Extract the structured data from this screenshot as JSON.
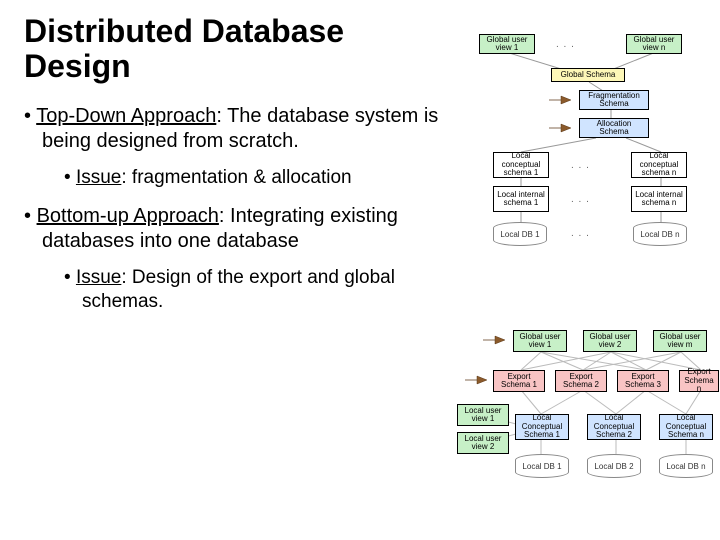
{
  "title": "Distributed Database Design",
  "bullets": {
    "b1_label": "Top-Down Approach",
    "b1_text": ":  The database system is being designed from scratch.",
    "b1_issue_label": "Issue",
    "b1_issue_text": ":  fragmentation & allocation",
    "b2_label": "Bottom-up Approach",
    "b2_text": ": Integrating existing databases into one database",
    "b2_issue_label": "Issue",
    "b2_issue_text": ":  Design of the export and global schemas."
  },
  "diagram1": {
    "global_user_view_1": "Global user view 1",
    "global_user_view_n": "Global user view n",
    "global_schema": "Global Schema",
    "fragmentation_schema": "Fragmentation Schema",
    "allocation_schema": "Allocation Schema",
    "local_conceptual_1": "Local conceptual schema 1",
    "local_conceptual_n": "Local conceptual schema n",
    "local_internal_1": "Local internal schema 1",
    "local_internal_n": "Local internal schema n",
    "local_db_1": "Local DB 1",
    "local_db_n": "Local DB n"
  },
  "diagram2": {
    "global_user_view_1": "Global user view 1",
    "global_user_view_2": "Global user view 2",
    "global_user_view_m": "Global user view m",
    "export_1": "Export Schema 1",
    "export_2": "Export Schema 2",
    "export_3": "Export Schema 3",
    "export_n": "Export Schema n",
    "local_user_view_1": "Local user view 1",
    "local_user_view_2": "Local user view 2",
    "local_conceptual_1": "Local Conceptual Schema 1",
    "local_conceptual_2": "Local Conceptual Schema 2",
    "local_conceptual_n": "Local Conceptual Schema n",
    "local_db_1": "Local DB 1",
    "local_db_2": "Local DB 2",
    "local_db_n": "Local DB n"
  }
}
